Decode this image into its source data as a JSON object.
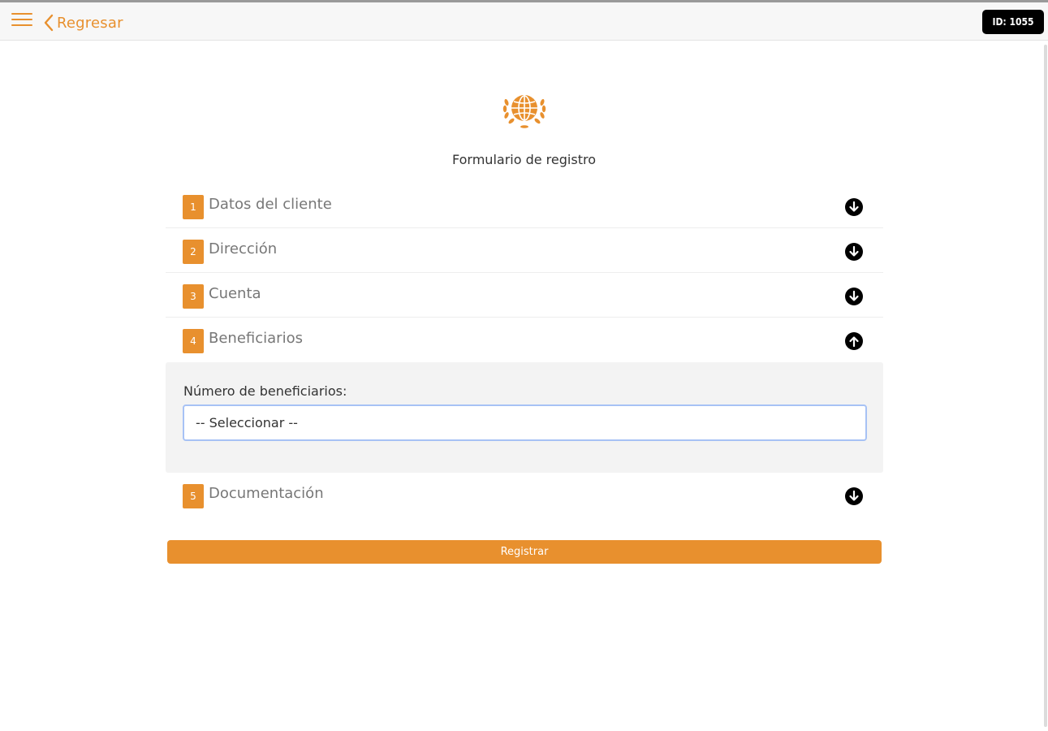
{
  "header": {
    "back_label": "Regresar",
    "id_badge": "ID: 1055"
  },
  "colors": {
    "accent": "#e8902e",
    "header_bg": "#f7f7f7",
    "panel_bg": "#f3f3f3",
    "badge_bg": "#000000",
    "select_focus_border": "#a7c2f5"
  },
  "icons": {
    "menu": "hamburger-icon",
    "back": "chevron-left-icon",
    "logo": "globe-laurel-icon",
    "expand": "arrow-down-circle-icon",
    "collapse": "arrow-up-circle-icon"
  },
  "form": {
    "title": "Formulario de registro",
    "sections": [
      {
        "number": "1",
        "label": "Datos del cliente",
        "expanded": false
      },
      {
        "number": "2",
        "label": "Dirección",
        "expanded": false
      },
      {
        "number": "3",
        "label": "Cuenta",
        "expanded": false
      },
      {
        "number": "4",
        "label": "Beneficiarios",
        "expanded": true
      },
      {
        "number": "5",
        "label": "Documentación",
        "expanded": false
      }
    ],
    "beneficiaries": {
      "field_label": "Número de beneficiarios:",
      "select_value": "-- Seleccionar --"
    },
    "submit_label": "Registrar"
  }
}
